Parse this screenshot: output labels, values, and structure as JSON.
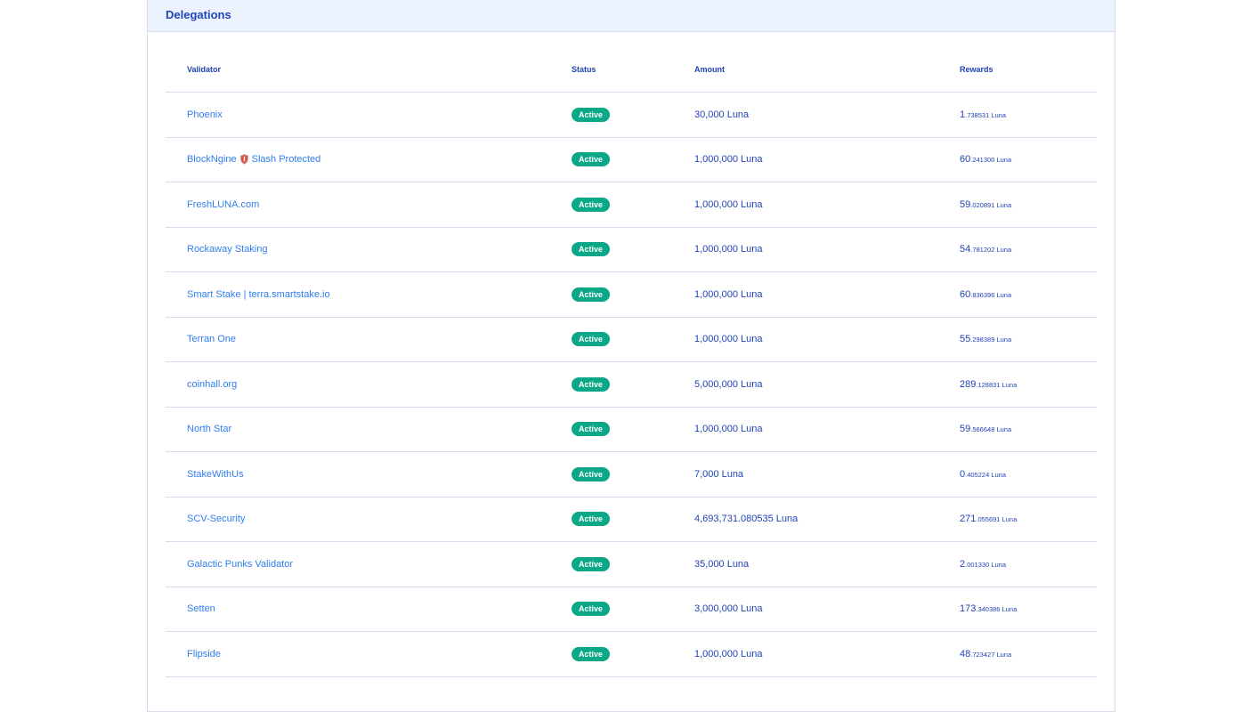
{
  "card": {
    "title": "Delegations"
  },
  "table": {
    "headers": [
      "Validator",
      "Status",
      "Amount",
      "Rewards"
    ],
    "rows": [
      {
        "validator": "Phoenix",
        "status": "Active",
        "amount": "30,000 Luna",
        "reward_int": "1",
        "reward_dec": ".738531 Luna"
      },
      {
        "validator": "BlockNgine",
        "validator_suffix": "Slash Protected",
        "icon": "shield-icon",
        "status": "Active",
        "amount": "1,000,000 Luna",
        "reward_int": "60",
        "reward_dec": ".241300 Luna"
      },
      {
        "validator": "FreshLUNA.com",
        "status": "Active",
        "amount": "1,000,000 Luna",
        "reward_int": "59",
        "reward_dec": ".020891 Luna"
      },
      {
        "validator": "Rockaway Staking",
        "status": "Active",
        "amount": "1,000,000 Luna",
        "reward_int": "54",
        "reward_dec": ".781202 Luna"
      },
      {
        "validator": "Smart Stake | terra.smartstake.io",
        "status": "Active",
        "amount": "1,000,000 Luna",
        "reward_int": "60",
        "reward_dec": ".836396 Luna"
      },
      {
        "validator": "Terran One",
        "status": "Active",
        "amount": "1,000,000 Luna",
        "reward_int": "55",
        "reward_dec": ".298389 Luna"
      },
      {
        "validator": "coinhall.org",
        "status": "Active",
        "amount": "5,000,000 Luna",
        "reward_int": "289",
        "reward_dec": ".128831 Luna"
      },
      {
        "validator": "North Star",
        "status": "Active",
        "amount": "1,000,000 Luna",
        "reward_int": "59",
        "reward_dec": ".566648 Luna"
      },
      {
        "validator": "StakeWithUs",
        "status": "Active",
        "amount": "7,000 Luna",
        "reward_int": "0",
        "reward_dec": ".405224 Luna"
      },
      {
        "validator": "SCV-Security",
        "status": "Active",
        "amount": "4,693,731.080535 Luna",
        "reward_int": "271",
        "reward_dec": ".055691 Luna"
      },
      {
        "validator": "Galactic Punks Validator",
        "status": "Active",
        "amount": "35,000 Luna",
        "reward_int": "2",
        "reward_dec": ".001330 Luna"
      },
      {
        "validator": "Setten",
        "status": "Active",
        "amount": "3,000,000 Luna",
        "reward_int": "173",
        "reward_dec": ".340386 Luna"
      },
      {
        "validator": "Flipside",
        "status": "Active",
        "amount": "1,000,000 Luna",
        "reward_int": "48",
        "reward_dec": ".723427 Luna"
      }
    ]
  },
  "colors": {
    "accent": "#2043b5",
    "link": "#2f7ef0",
    "active": "#0aa887",
    "header_bg": "#ecf2fe"
  }
}
